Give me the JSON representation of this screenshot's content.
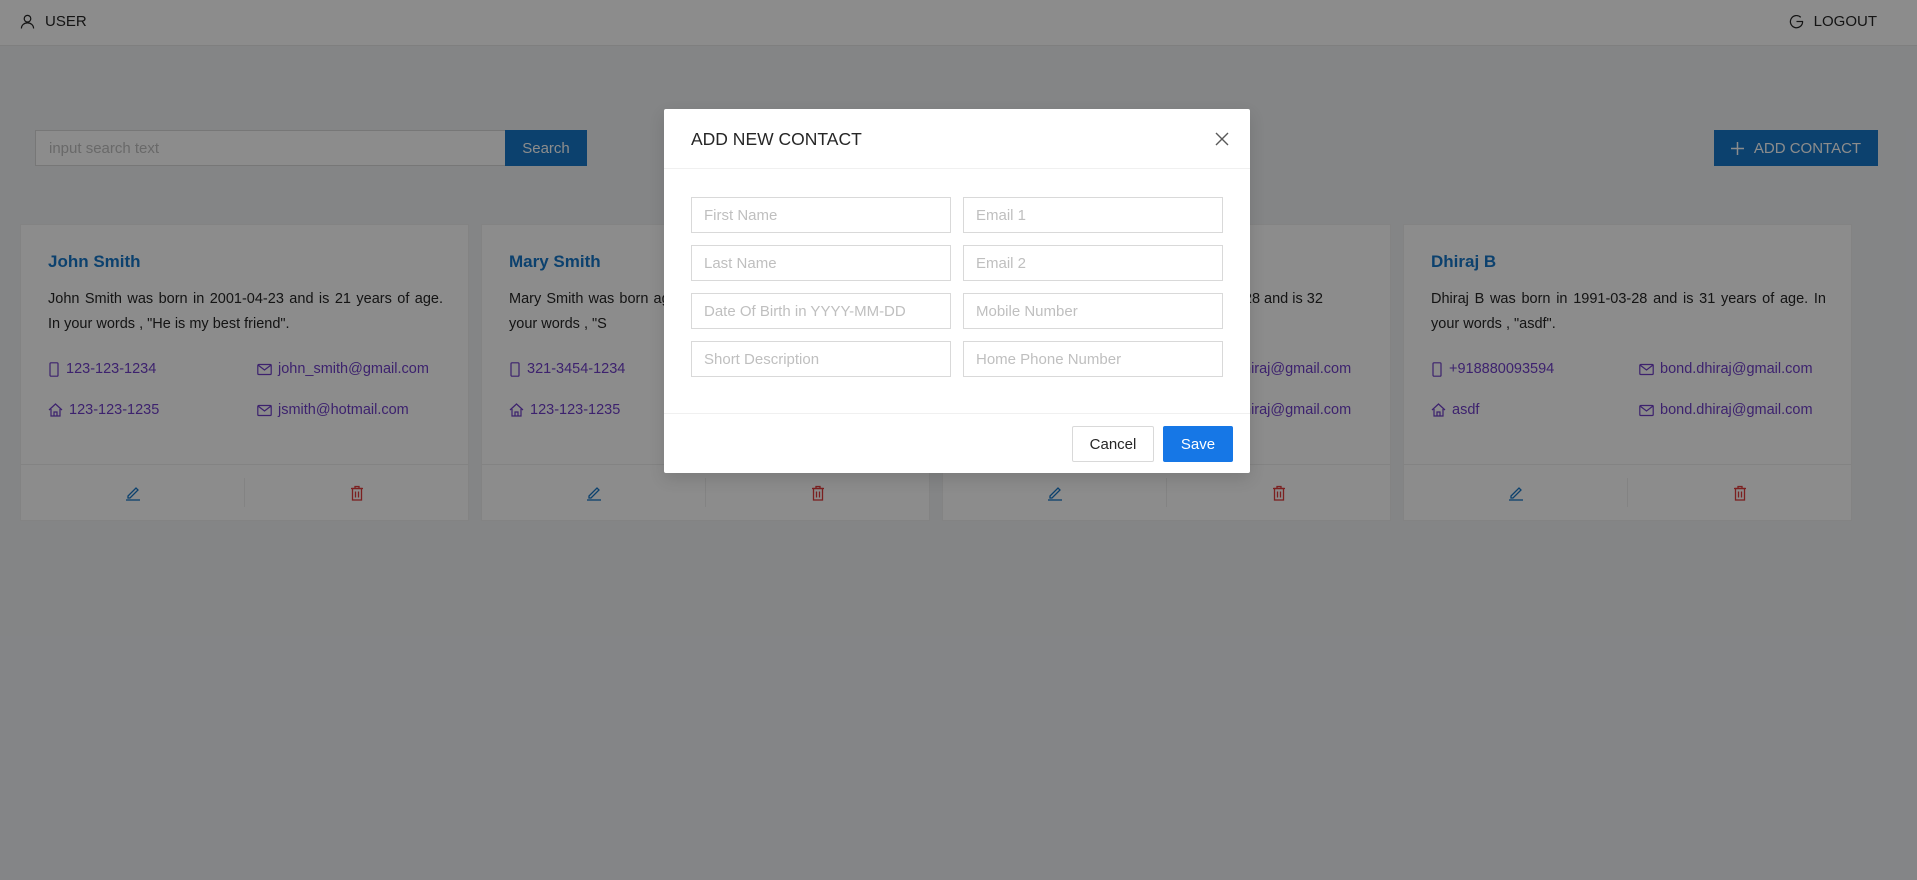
{
  "header": {
    "user_label": "USER",
    "logout_label": "LOGOUT"
  },
  "search": {
    "placeholder": "input search text",
    "value": "",
    "button_label": "Search"
  },
  "add_contact_label": "ADD CONTACT",
  "contacts": [
    {
      "name": "John Smith",
      "description": "John Smith was born in 2001-04-23 and is 21 years of age. In your words , \"He is my best friend\".",
      "mobile": "123-123-1234",
      "email1": "john_smith@gmail.com",
      "home": "123-123-1235",
      "email2": "jsmith@hotmail.com"
    },
    {
      "name": "Mary Smith",
      "description": "Mary Smith was born age. In your words , \"S",
      "mobile": "321-3454-1234",
      "email1": "",
      "home": "123-123-1235",
      "email2": ""
    },
    {
      "name": "",
      "description": "3-28 and is 32",
      "mobile": "",
      "email1": "hiraj@gmail.com",
      "home": "",
      "email2": "hiraj@gmail.com"
    },
    {
      "name": "Dhiraj B",
      "description": "Dhiraj B was born in 1991-03-28 and is 31 years of age. In your words , \"asdf\".",
      "mobile": "+918880093594",
      "email1": "bond.dhiraj@gmail.com",
      "home": "asdf",
      "email2": "bond.dhiraj@gmail.com"
    }
  ],
  "modal": {
    "title": "ADD NEW CONTACT",
    "fields": {
      "first_name": "First Name",
      "email1": "Email 1",
      "last_name": "Last Name",
      "email2": "Email 2",
      "dob": "Date Of Birth in YYYY-MM-DD",
      "mobile": "Mobile Number",
      "short_desc": "Short Description",
      "home_phone": "Home Phone Number"
    },
    "cancel_label": "Cancel",
    "save_label": "Save"
  },
  "colors": {
    "primary": "#1677c8",
    "link": "#6f3fc8",
    "delete": "#e03b3b",
    "overlay": "rgba(0,0,0,0.45)"
  },
  "icons": [
    "user-icon",
    "logout-icon",
    "plus-icon",
    "mobile-icon",
    "mail-icon",
    "home-icon",
    "edit-icon",
    "delete-icon",
    "close-icon"
  ]
}
